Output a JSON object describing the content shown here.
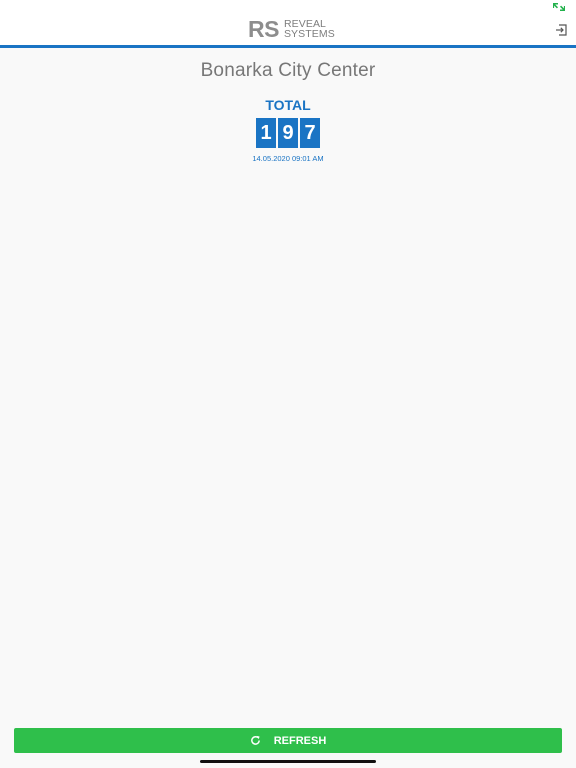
{
  "header": {
    "logo_mark": "RS",
    "logo_line1": "REVEAL",
    "logo_line2": "SYSTEMS"
  },
  "location": {
    "title": "Bonarka City Center"
  },
  "counter": {
    "label": "TOTAL",
    "digits": [
      "1",
      "9",
      "7"
    ],
    "timestamp": "14.05.2020 09:01 AM"
  },
  "actions": {
    "refresh_label": "REFRESH"
  },
  "icons": {
    "status": "fullscreen-arrows-icon",
    "logout": "logout-icon",
    "refresh": "refresh-icon"
  },
  "colors": {
    "brand_blue": "#1a74c4",
    "refresh_green": "#2fbf4b",
    "status_green": "#22b14c"
  }
}
